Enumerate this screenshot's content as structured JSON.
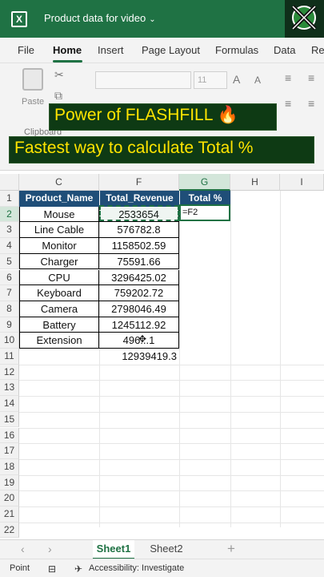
{
  "window": {
    "app_icon": "excel-icon",
    "title": "Product data for video"
  },
  "menu": [
    "File",
    "Home",
    "Insert",
    "Page Layout",
    "Formulas",
    "Data",
    "Re"
  ],
  "ribbon": {
    "paste_label": "Paste",
    "font_size": "11",
    "clipboard_label": "Clipboard"
  },
  "banner": {
    "line1": "Power of FLASHFILL 🔥",
    "line2": "Fastest way to calculate Total %"
  },
  "columns": [
    "C",
    "F",
    "G",
    "H",
    "I"
  ],
  "rows": [
    "1",
    "2",
    "3",
    "4",
    "5",
    "6",
    "7",
    "8",
    "9",
    "10",
    "11",
    "12",
    "13",
    "14",
    "15",
    "16",
    "17",
    "18",
    "19",
    "20",
    "21",
    "22"
  ],
  "table": {
    "headers": [
      "Product_Name",
      "Total_Revenue",
      "Total %"
    ],
    "products": [
      "Mouse",
      "Line Cable",
      "Monitor",
      "Charger",
      "CPU",
      "Keyboard",
      "Camera",
      "Battery",
      "Extension"
    ],
    "revenues": [
      "2533654",
      "576782.8",
      "1158502.59",
      "75591.66",
      "3296425.02",
      "759202.72",
      "2798046.49",
      "1245112.92",
      "496...1"
    ],
    "total": "12939419.3"
  },
  "formula_entry": "=F2",
  "sheets": [
    "Sheet1",
    "Sheet2"
  ],
  "status": {
    "mode": "Point",
    "accessibility": "Accessibility: Investigate"
  },
  "colors": {
    "excel_green": "#1f7244",
    "header_blue": "#1f4e78",
    "banner_bg": "#0e3a14",
    "banner_text": "#ffe400"
  }
}
